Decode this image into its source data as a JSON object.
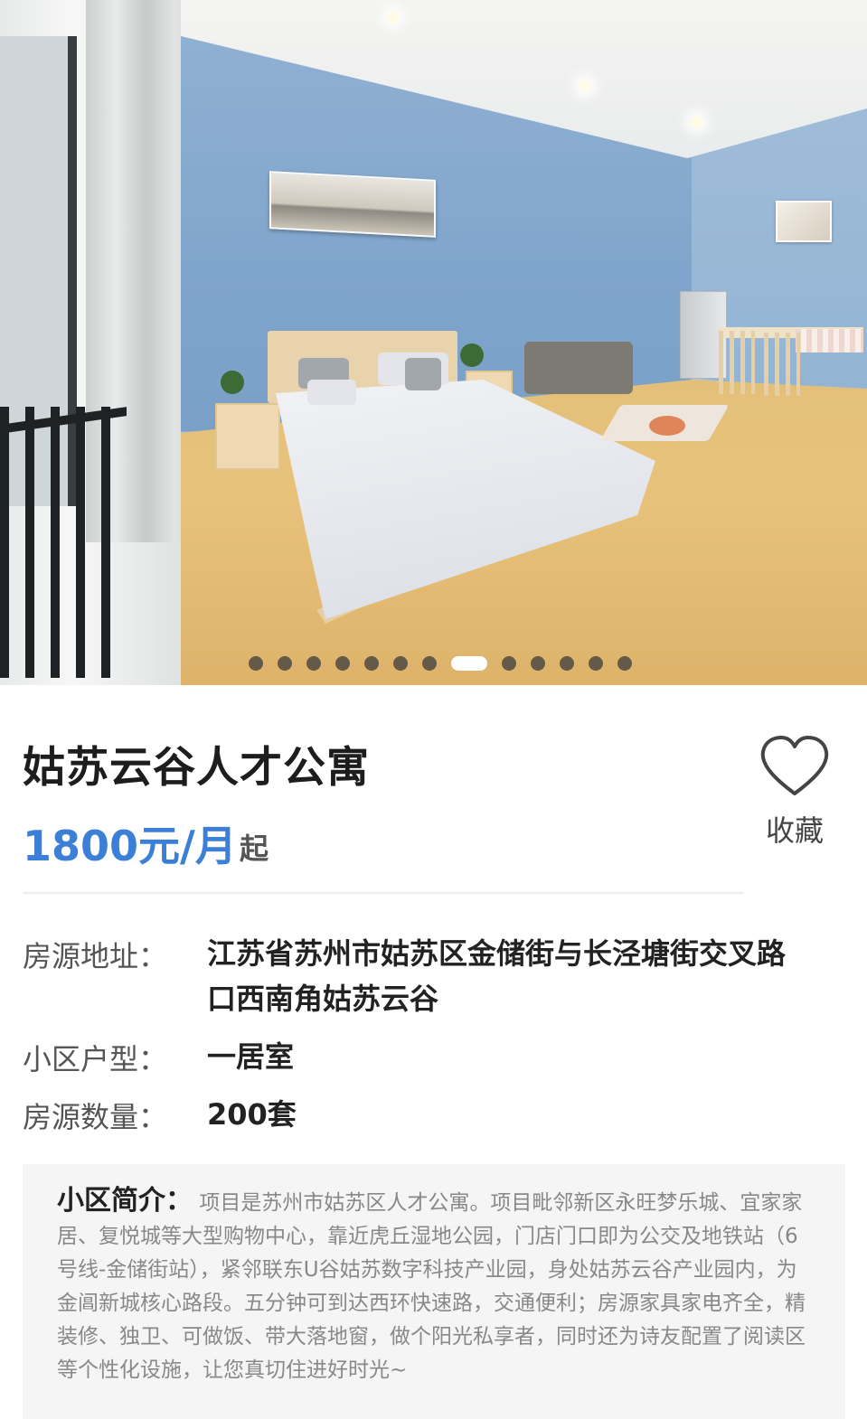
{
  "listing": {
    "title": "姑苏云谷人才公寓",
    "price": "1800元/月",
    "price_suffix": "起",
    "favorite_label": "收藏"
  },
  "carousel": {
    "total": 13,
    "active_index": 7
  },
  "details": [
    {
      "label": "房源地址：",
      "value_line1": "江苏省苏州市姑苏区金储街与长泾塘街交叉路",
      "value_line2": "口西南角姑苏云谷"
    },
    {
      "label": "小区户型：",
      "value": "一居室"
    },
    {
      "label": "房源数量：",
      "value": "200套"
    }
  ],
  "intro": {
    "label": "小区简介：",
    "text": "项目是苏州市姑苏区人才公寓。项目毗邻新区永旺梦乐城、宜家家居、复悦城等大型购物中心，靠近虎丘湿地公园，门店门口即为公交及地铁站（6号线-金储街站），紧邻联东U谷姑苏数字科技产业园，身处姑苏云谷产业园内，为金阊新城核心路段。五分钟可到达西环快速路，交通便利；房源家具家电齐全，精装修、独卫、可做饭、带大落地窗，做个阳光私享者，同时还为诗友配置了阅读区等个性化设施，让您真切住进好时光~"
  },
  "colors": {
    "price": "#3c7fd6",
    "intro_bg": "#f5f5f5"
  }
}
